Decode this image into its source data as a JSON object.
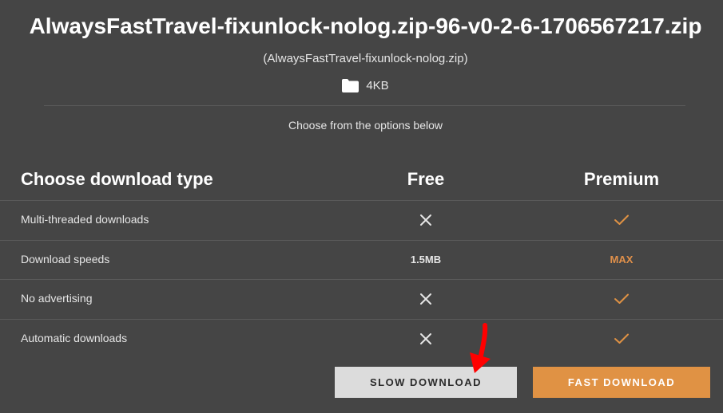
{
  "file": {
    "title": "AlwaysFastTravel-fixunlock-nolog.zip-96-v0-2-6-1706567217.zip",
    "original_name": "(AlwaysFastTravel-fixunlock-nolog.zip)",
    "size": "4KB",
    "size_icon": "folder-icon"
  },
  "instructions": "Choose from the options below",
  "comparison": {
    "headers": {
      "type": "Choose download type",
      "free": "Free",
      "premium": "Premium"
    },
    "rows": [
      {
        "label": "Multi-threaded downloads",
        "free": "cross-icon",
        "premium": "check-icon"
      },
      {
        "label": "Download speeds",
        "free": "1.5MB",
        "premium": "MAX"
      },
      {
        "label": "No advertising",
        "free": "cross-icon",
        "premium": "check-icon"
      },
      {
        "label": "Automatic downloads",
        "free": "cross-icon",
        "premium": "check-icon"
      }
    ]
  },
  "buttons": {
    "slow": "SLOW DOWNLOAD",
    "fast": "FAST DOWNLOAD"
  },
  "colors": {
    "background": "#454545",
    "accent": "#e09244",
    "slow_button": "#dcdcdc",
    "annotation_arrow": "#ff0000"
  }
}
